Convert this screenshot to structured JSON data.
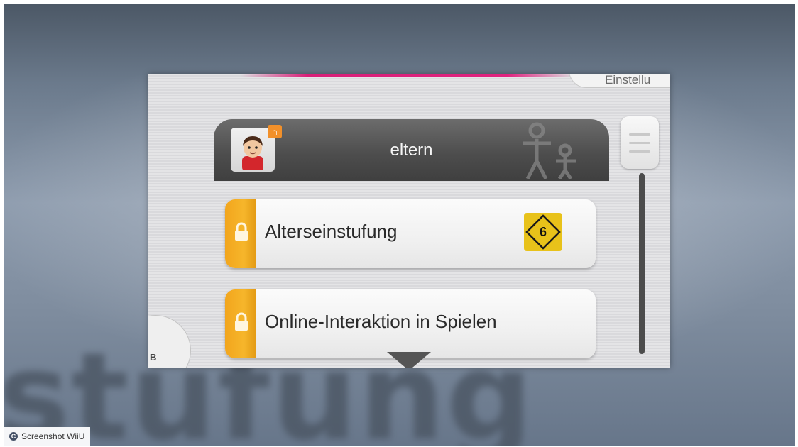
{
  "background": {
    "word": "stufung"
  },
  "screen": {
    "top_tab_label": "Einstellu",
    "b_button_label": "B",
    "accent_color": "#d81f78"
  },
  "user": {
    "name": "eltern",
    "badge_icon": "parent-key-icon"
  },
  "items": [
    {
      "label": "Alterseinstufung",
      "icon": "lock-icon",
      "age_rating": "6"
    },
    {
      "label": "Online-Interaktion in Spielen",
      "icon": "lock-icon"
    }
  ],
  "caption": {
    "icon": "copyright-icon",
    "text": "Screenshot WiiU"
  },
  "colors": {
    "lock_tab": "#f2a51d",
    "header": "#4e4e4e",
    "age_badge": "#e8c21a"
  }
}
